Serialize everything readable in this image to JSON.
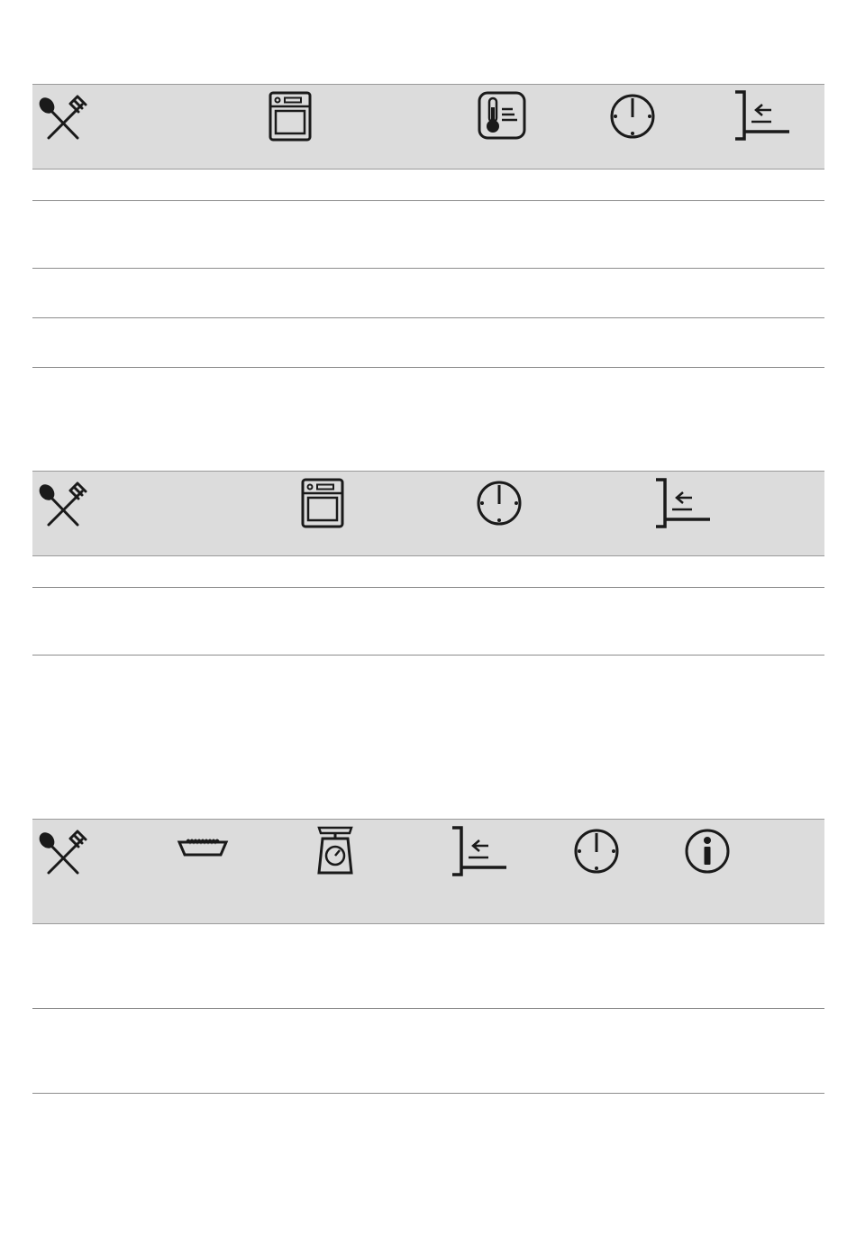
{
  "tables": [
    {
      "header_icons": [
        "cutlery-icon",
        "oven-icon",
        "thermometer-icon",
        "clock-icon",
        "shelf-level-icon"
      ],
      "rows": 4
    },
    {
      "header_icons": [
        "cutlery-icon",
        "oven-icon",
        "clock-icon",
        "shelf-level-icon"
      ],
      "rows": 2
    },
    {
      "header_icons": [
        "cutlery-icon",
        "baking-dish-icon",
        "kitchen-scale-icon",
        "shelf-level-icon",
        "clock-icon",
        "info-icon"
      ],
      "rows": 2
    }
  ],
  "colors": {
    "header_background": "#dcdcdc",
    "rule": "#8c8c8c",
    "icon": "#1a1a1a"
  }
}
